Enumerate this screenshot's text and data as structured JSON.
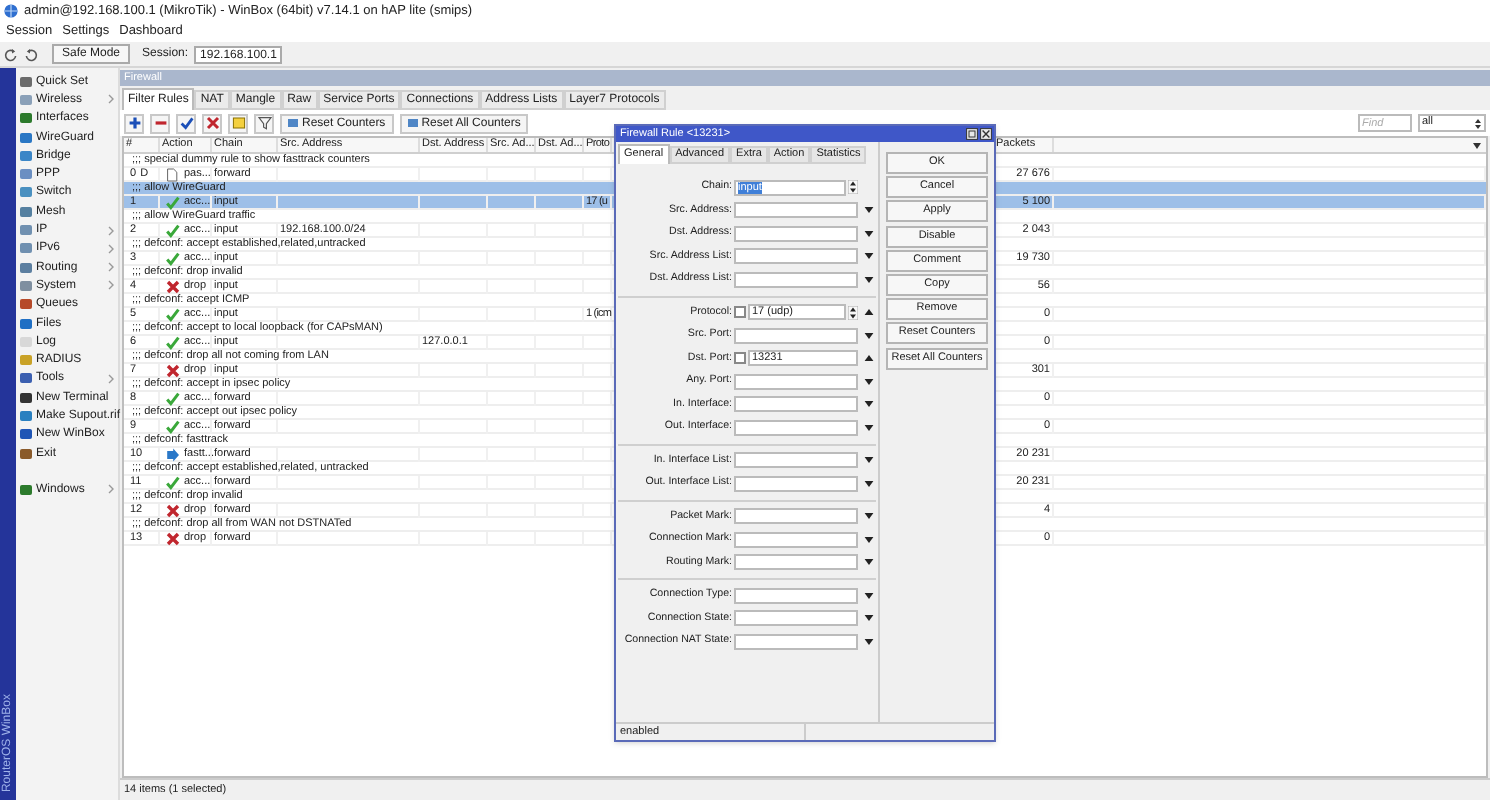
{
  "window": {
    "title": "admin@192.168.100.1 (MikroTik) - WinBox (64bit) v7.14.1 on hAP lite (smips)"
  },
  "menu": [
    "Session",
    "Settings",
    "Dashboard"
  ],
  "toolbar": {
    "safe_mode": "Safe Mode",
    "session_label": "Session:",
    "session_value": "192.168.100.1"
  },
  "sidebar": {
    "brand": "RouterOS WinBox",
    "items": [
      {
        "label": "Quick Set",
        "submenu": false
      },
      {
        "label": "Wireless",
        "submenu": true
      },
      {
        "label": "Interfaces",
        "submenu": false
      },
      {
        "label": "WireGuard",
        "submenu": false
      },
      {
        "label": "Bridge",
        "submenu": false
      },
      {
        "label": "PPP",
        "submenu": false
      },
      {
        "label": "Switch",
        "submenu": false
      },
      {
        "label": "Mesh",
        "submenu": false
      },
      {
        "label": "IP",
        "submenu": true
      },
      {
        "label": "IPv6",
        "submenu": true
      },
      {
        "label": "Routing",
        "submenu": true
      },
      {
        "label": "System",
        "submenu": true
      },
      {
        "label": "Queues",
        "submenu": false
      },
      {
        "label": "Files",
        "submenu": false
      },
      {
        "label": "Log",
        "submenu": false
      },
      {
        "label": "RADIUS",
        "submenu": false
      },
      {
        "label": "Tools",
        "submenu": true
      },
      {
        "label": "New Terminal",
        "submenu": false
      },
      {
        "label": "Make Supout.rif",
        "submenu": false
      },
      {
        "label": "New WinBox",
        "submenu": false
      },
      {
        "label": "Exit",
        "submenu": false
      }
    ],
    "windows": {
      "label": "Windows",
      "submenu": true
    }
  },
  "firewall": {
    "title": "Firewall",
    "tabs": [
      {
        "label": "Filter Rules",
        "selected": true
      },
      {
        "label": "NAT",
        "selected": false
      },
      {
        "label": "Mangle",
        "selected": false
      },
      {
        "label": "Raw",
        "selected": false
      },
      {
        "label": "Service Ports",
        "selected": false
      },
      {
        "label": "Connections",
        "selected": false
      },
      {
        "label": "Address Lists",
        "selected": false
      },
      {
        "label": "Layer7 Protocols",
        "selected": false
      }
    ],
    "buttons": [
      "Reset Counters",
      "Reset All Counters"
    ],
    "find": {
      "placeholder": "Find"
    },
    "filter": "all",
    "columns": [
      "#",
      "Action",
      "Chain",
      "Src. Address",
      "Dst. Address",
      "Src. Ad...",
      "Dst. Ad...",
      "Proto",
      "Packets"
    ],
    "rows": [
      {
        "comment": ";;; special dummy rule to show fasttrack counters",
        "number": "0",
        "flag": "D",
        "kind": "passthrough",
        "action_label": "pas...",
        "chain": "forward",
        "packets": "27 676",
        "selected": false
      },
      {
        "comment": ";;; allow WireGuard",
        "number": "1",
        "kind": "accept",
        "action_label": "acc...",
        "chain": "input",
        "proto": "17 (u",
        "packets": "5 100",
        "selected": true
      },
      {
        "comment": ";;; allow WireGuard traffic",
        "number": "2",
        "kind": "accept",
        "action_label": "acc...",
        "chain": "input",
        "src": "192.168.100.0/24",
        "packets": "2 043",
        "selected": false
      },
      {
        "comment": ";;; defconf: accept established,related,untracked",
        "number": "3",
        "kind": "accept",
        "action_label": "acc...",
        "chain": "input",
        "packets": "19 730",
        "selected": false
      },
      {
        "comment": ";;; defconf: drop invalid",
        "number": "4",
        "kind": "drop",
        "action_label": "drop",
        "chain": "input",
        "packets": "56",
        "selected": false
      },
      {
        "comment": ";;; defconf: accept ICMP",
        "number": "5",
        "kind": "accept",
        "action_label": "acc...",
        "chain": "input",
        "proto": "1 (icm",
        "packets": "0",
        "selected": false
      },
      {
        "comment": ";;; defconf: accept to local loopback (for CAPsMAN)",
        "number": "6",
        "kind": "accept",
        "action_label": "acc...",
        "chain": "input",
        "dst": "127.0.0.1",
        "packets": "0",
        "selected": false
      },
      {
        "comment": ";;; defconf: drop all not coming from LAN",
        "number": "7",
        "kind": "drop",
        "action_label": "drop",
        "chain": "input",
        "packets": "301",
        "selected": false
      },
      {
        "comment": ";;; defconf: accept in ipsec policy",
        "number": "8",
        "kind": "accept",
        "action_label": "acc...",
        "chain": "forward",
        "packets": "0",
        "selected": false
      },
      {
        "comment": ";;; defconf: accept out ipsec policy",
        "number": "9",
        "kind": "accept",
        "action_label": "acc...",
        "chain": "forward",
        "packets": "0",
        "selected": false
      },
      {
        "comment": ";;; defconf: fasttrack",
        "number": "10",
        "kind": "fasttrack",
        "action_label": "fastt...",
        "chain": "forward",
        "packets": "20 231",
        "selected": false
      },
      {
        "comment": ";;; defconf: accept established,related, untracked",
        "number": "11",
        "kind": "accept",
        "action_label": "acc...",
        "chain": "forward",
        "packets": "20 231",
        "selected": false
      },
      {
        "comment": ";;; defconf: drop invalid",
        "number": "12",
        "kind": "drop",
        "action_label": "drop",
        "chain": "forward",
        "packets": "4",
        "selected": false
      },
      {
        "comment": ";;; defconf: drop all from WAN not DSTNATed",
        "number": "13",
        "kind": "drop",
        "action_label": "drop",
        "chain": "forward",
        "packets": "0",
        "selected": false
      }
    ],
    "status": "14 items (1 selected)"
  },
  "dialog": {
    "title": "Firewall Rule <13231>",
    "tabs": [
      {
        "label": "General",
        "selected": true
      },
      {
        "label": "Advanced",
        "selected": false
      },
      {
        "label": "Extra",
        "selected": false
      },
      {
        "label": "Action",
        "selected": false
      },
      {
        "label": "Statistics",
        "selected": false
      }
    ],
    "groups": [
      [
        {
          "label": "Chain:",
          "kind": "chain",
          "value": "input",
          "text_selected": true
        },
        {
          "label": "Src. Address:",
          "kind": "dropdown"
        },
        {
          "label": "Dst. Address:",
          "kind": "dropdown"
        },
        {
          "label": "Src. Address List:",
          "kind": "dropdown"
        },
        {
          "label": "Dst. Address List:",
          "kind": "dropdown"
        }
      ],
      [
        {
          "label": "Protocol:",
          "kind": "protocol",
          "checked": false,
          "value": "17 (udp)"
        },
        {
          "label": "Src. Port:",
          "kind": "dropdown"
        },
        {
          "label": "Dst. Port:",
          "kind": "port",
          "checked": false,
          "value": "13231"
        },
        {
          "label": "Any. Port:",
          "kind": "dropdown"
        },
        {
          "label": "In. Interface:",
          "kind": "dropdown"
        },
        {
          "label": "Out. Interface:",
          "kind": "dropdown"
        }
      ],
      [
        {
          "label": "In. Interface List:",
          "kind": "dropdown"
        },
        {
          "label": "Out. Interface List:",
          "kind": "dropdown"
        }
      ],
      [
        {
          "label": "Packet Mark:",
          "kind": "dropdown"
        },
        {
          "label": "Connection Mark:",
          "kind": "dropdown"
        },
        {
          "label": "Routing Mark:",
          "kind": "dropdown"
        }
      ],
      [
        {
          "label": "Connection Type:",
          "kind": "dropdown"
        },
        {
          "label": "Connection State:",
          "kind": "dropdown"
        },
        {
          "label": "Connection NAT State:",
          "kind": "dropdown"
        }
      ]
    ],
    "buttons": [
      "OK",
      "Cancel",
      "Apply",
      "Disable",
      "Comment",
      "Copy",
      "Remove",
      "Reset Counters",
      "Reset All Counters"
    ],
    "status": "enabled"
  }
}
